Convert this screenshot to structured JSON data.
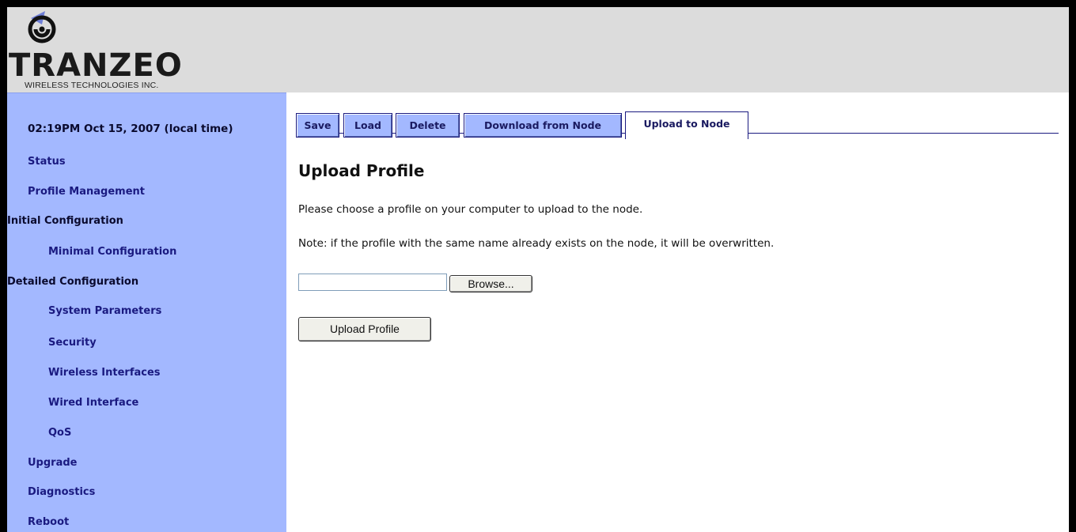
{
  "brand": {
    "logo_text": "TRANZEO",
    "tagline": "WIRELESS TECHNOLOGIES INC."
  },
  "sidebar": {
    "timestamp": "02:19PM Oct 15, 2007 (local time)",
    "items": [
      {
        "label": "Status"
      },
      {
        "label": "Profile Management"
      },
      {
        "label": "Initial Configuration"
      },
      {
        "label": "Minimal Configuration"
      },
      {
        "label": "Detailed Configuration"
      },
      {
        "label": "System Parameters"
      },
      {
        "label": "Security"
      },
      {
        "label": "Wireless Interfaces"
      },
      {
        "label": "Wired Interface"
      },
      {
        "label": "QoS"
      },
      {
        "label": "Upgrade"
      },
      {
        "label": "Diagnostics"
      },
      {
        "label": "Reboot"
      }
    ]
  },
  "tabs": [
    {
      "label": "Save"
    },
    {
      "label": "Load"
    },
    {
      "label": "Delete"
    },
    {
      "label": "Download from Node"
    },
    {
      "label": "Upload to Node",
      "active": true
    }
  ],
  "main": {
    "title": "Upload Profile",
    "instruction": "Please choose a profile on your computer to upload to the node.",
    "note": "Note: if the profile with the same name already exists on the node, it will be overwritten.",
    "file_value": "",
    "browse_label": "Browse...",
    "upload_label": "Upload Profile"
  },
  "colors": {
    "sidebar_bg": "#a3b8ff",
    "header_bg": "#dcdcdc",
    "link": "#1a1a80"
  }
}
